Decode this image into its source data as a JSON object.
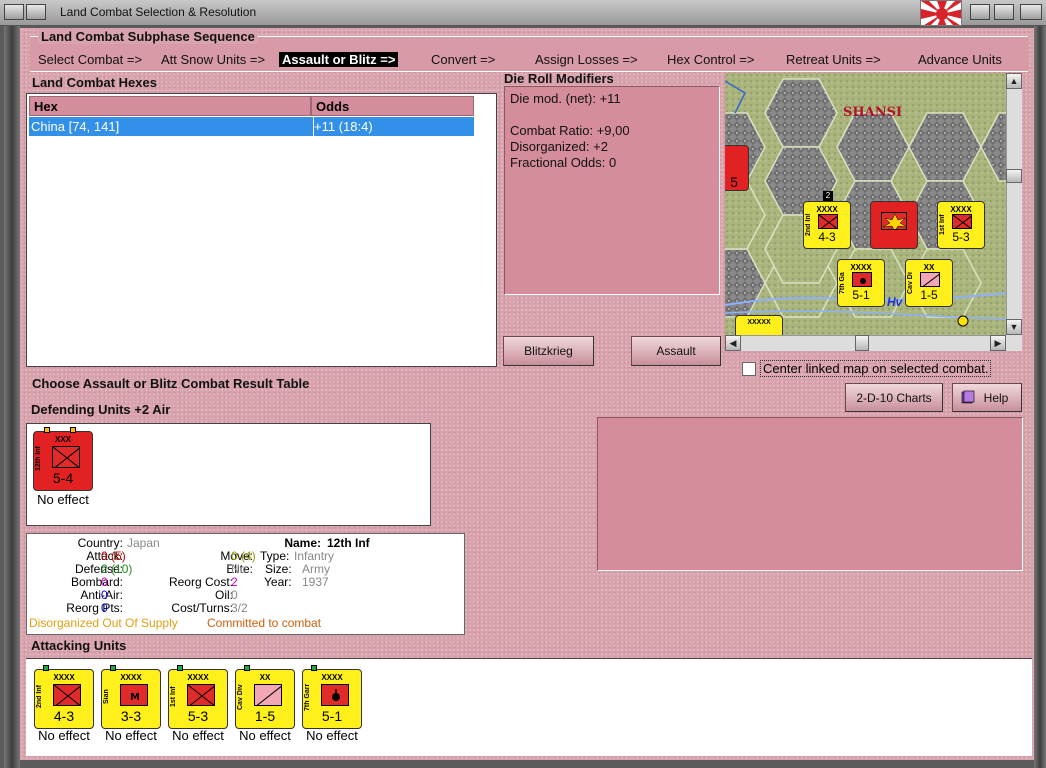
{
  "window": {
    "title": "Land Combat Selection & Resolution",
    "colors": {
      "panel_pink": "#d9a3ad",
      "header_pink": "#d58d9b",
      "selection_blue": "#3390e8",
      "unit_yellow": "#ffef1a",
      "unit_red": "#e22222"
    }
  },
  "subphase": {
    "title": "Land Combat Subphase Sequence",
    "steps": [
      "Select Combat =>",
      "Att Snow Units =>",
      "Assault or Blitz =>",
      "Convert =>",
      "Assign Losses =>",
      "Hex Control =>",
      "Retreat Units =>",
      "Advance Units"
    ],
    "active_index": 2
  },
  "hexes": {
    "title": "Land Combat Hexes",
    "columns": [
      "Hex",
      "Odds"
    ],
    "rows": [
      {
        "hex": "China [74, 141]",
        "odds": "+11 (18:4)"
      }
    ]
  },
  "die_roll": {
    "title": "Die Roll Modifiers",
    "net": "Die mod. (net): +11",
    "lines": [
      "Combat Ratio: +9,00",
      "Disorganized: +2",
      "Fractional Odds: 0"
    ]
  },
  "map": {
    "region_label": "SHANSI",
    "counters": [
      {
        "size": "XXXX",
        "name": "2nd Inf",
        "value": "4-3",
        "color": "yellow"
      },
      {
        "size": "XXXX",
        "name": "",
        "value": "5",
        "color": "red"
      },
      {
        "size": "XXXX",
        "name": "1st Inf",
        "value": "5-3",
        "color": "yellow"
      },
      {
        "size": "XXXX",
        "name": "7th Garr",
        "value": "5-1",
        "color": "yellow"
      },
      {
        "size": "XX",
        "name": "Cav Div",
        "value": "1-5",
        "color": "yellow"
      }
    ],
    "stack_count": "2"
  },
  "buttons": {
    "blitzkrieg": "Blitzkrieg",
    "assault": "Assault",
    "charts": "2-D-10 Charts",
    "help": "Help",
    "center_label": "Center linked map on selected combat."
  },
  "choose_label": "Choose Assault or Blitz Combat Result Table",
  "defending": {
    "title": "Defending Units +2 Air",
    "units": [
      {
        "size": "XXX",
        "name": "12th Inf",
        "value": "5-4",
        "status": "No effect"
      }
    ]
  },
  "info": {
    "country_label": "Country:",
    "country": "Japan",
    "name_label": "Name:",
    "name": "12th Inf",
    "attack_label": "Attack:",
    "attack": "0",
    "attack_paren": "(5)",
    "move_label": "Move:",
    "move": "0",
    "move_paren": "(4)",
    "type_label": "Type:",
    "type": "Infantry",
    "defense_label": "Defense:",
    "defense": "2",
    "defense_paren": "(10)",
    "elite_label": "Elite:",
    "elite": "No",
    "size_label": "Size:",
    "size": "Army",
    "bombard_label": "Bombard:",
    "bombard": "0",
    "reorg_cost_label": "Reorg Cost:",
    "reorg_cost": "2",
    "year_label": "Year:",
    "year": "1937",
    "antiair_label": "Anti-Air:",
    "antiair": "0",
    "oil_label": "Oil:",
    "oil": "0",
    "reorg_pts_label": "Reorg Pts:",
    "reorg_pts": "0",
    "cost_turns_label": "Cost/Turns:",
    "cost_turns": "3/2",
    "status_disorg": "Disorganized Out Of Supply",
    "status_committed": "Committed to combat"
  },
  "attacking": {
    "title": "Attacking Units",
    "units": [
      {
        "size": "XXXX",
        "name": "2nd Inf",
        "value": "4-3",
        "status": "No effect",
        "symbol": "inf"
      },
      {
        "size": "XXXX",
        "name": "Sian",
        "value": "3-3",
        "status": "No effect",
        "symbol": "mtn"
      },
      {
        "size": "XXXX",
        "name": "1st Inf",
        "value": "5-3",
        "status": "No effect",
        "symbol": "inf"
      },
      {
        "size": "XX",
        "name": "Cav Div",
        "value": "1-5",
        "status": "No effect",
        "symbol": "cav"
      },
      {
        "size": "XXXX",
        "name": "7th Garr",
        "value": "5-1",
        "status": "No effect",
        "symbol": "garr"
      }
    ]
  }
}
